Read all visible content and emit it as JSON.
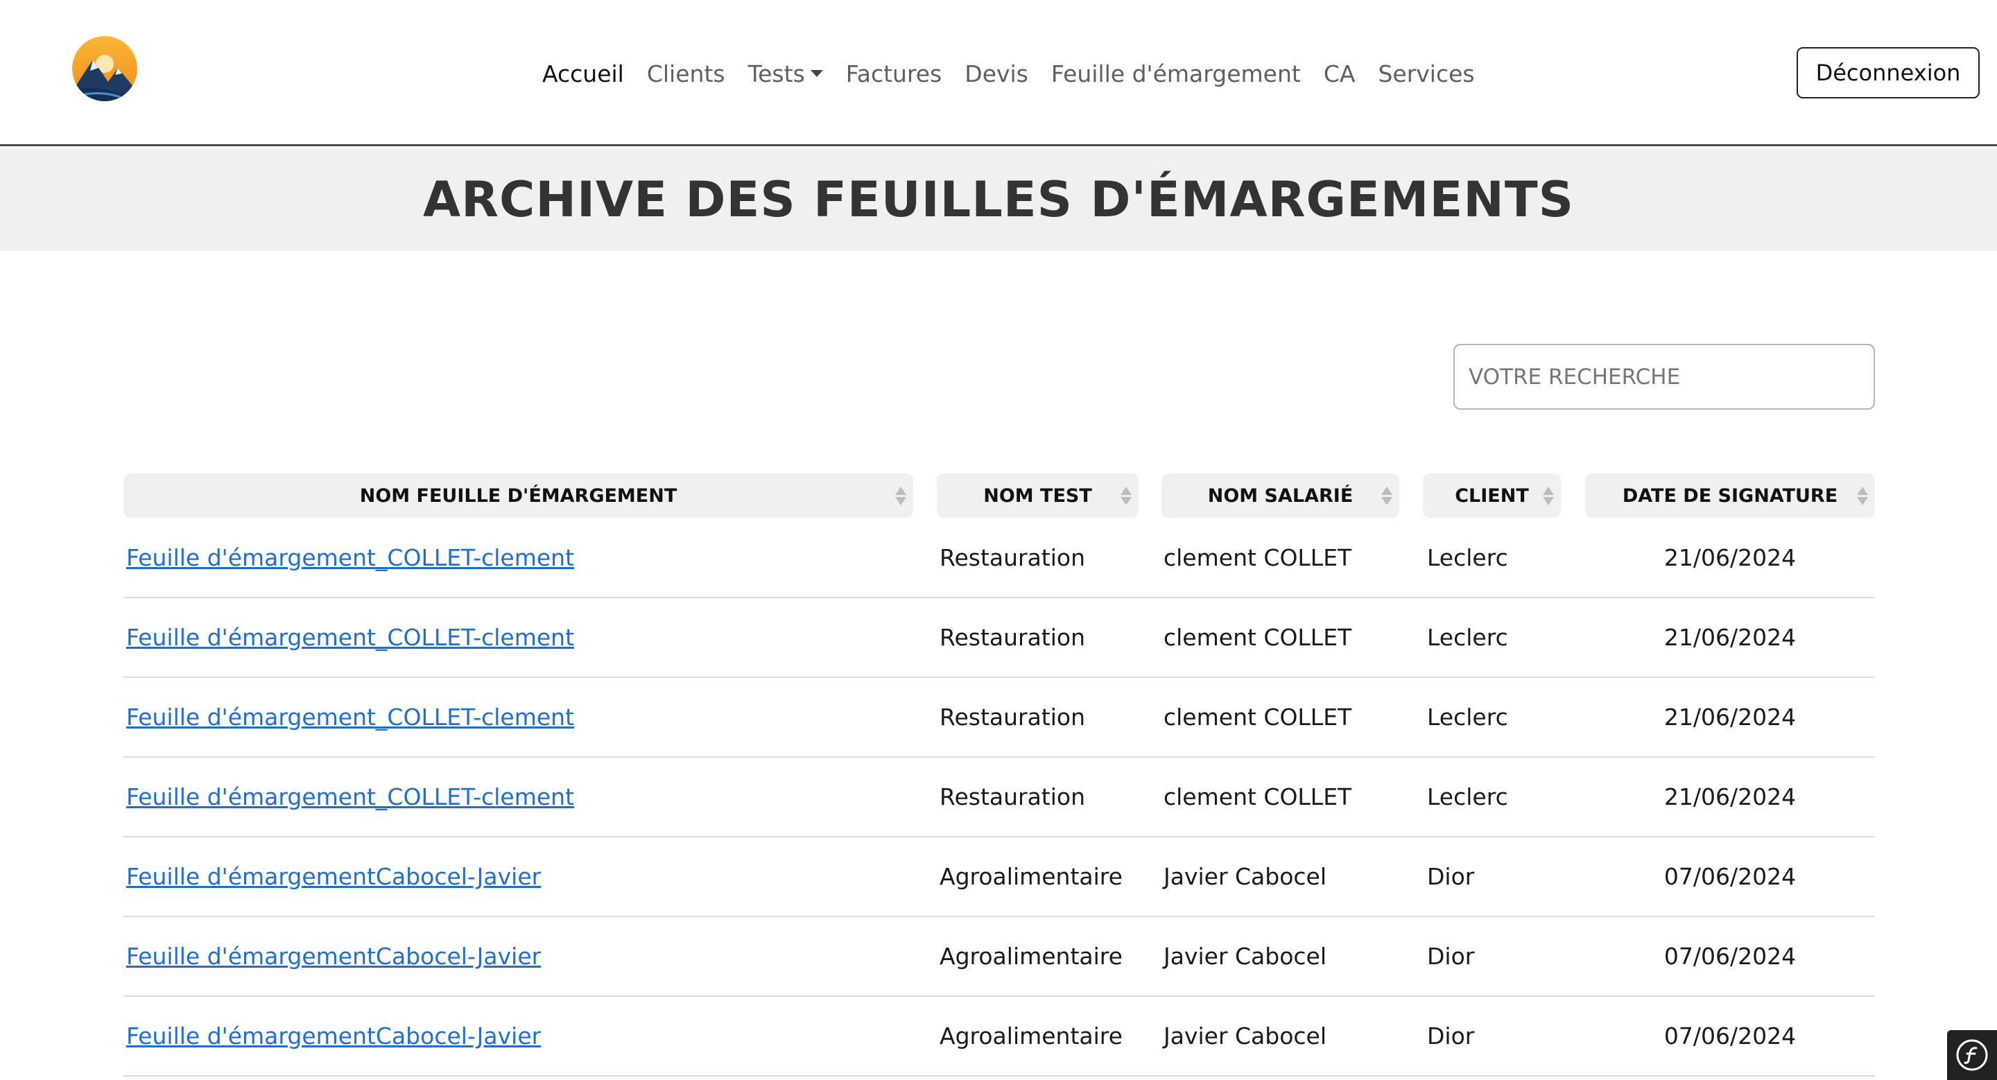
{
  "nav": {
    "items": [
      {
        "label": "Accueil",
        "active": true
      },
      {
        "label": "Clients"
      },
      {
        "label": "Tests",
        "dropdown": true
      },
      {
        "label": "Factures"
      },
      {
        "label": "Devis"
      },
      {
        "label": "Feuille d'émargement"
      },
      {
        "label": "CA"
      },
      {
        "label": "Services"
      }
    ],
    "logout_label": "Déconnexion"
  },
  "page": {
    "title": "ARCHIVE DES FEUILLES D'ÉMARGEMENTS"
  },
  "search": {
    "placeholder": "VOTRE RECHERCHE",
    "value": ""
  },
  "table": {
    "headers": [
      "NOM FEUILLE D'ÉMARGEMENT",
      "NOM TEST",
      "NOM SALARIÉ",
      "CLIENT",
      "DATE DE SIGNATURE"
    ],
    "rows": [
      {
        "sheet": "Feuille d'émargement_COLLET-clement",
        "test": "Restauration",
        "employee": "clement COLLET",
        "client": "Leclerc",
        "date": "21/06/2024"
      },
      {
        "sheet": "Feuille d'émargement_COLLET-clement",
        "test": "Restauration",
        "employee": "clement COLLET",
        "client": "Leclerc",
        "date": "21/06/2024"
      },
      {
        "sheet": "Feuille d'émargement_COLLET-clement",
        "test": "Restauration",
        "employee": "clement COLLET",
        "client": "Leclerc",
        "date": "21/06/2024"
      },
      {
        "sheet": "Feuille d'émargement_COLLET-clement",
        "test": "Restauration",
        "employee": "clement COLLET",
        "client": "Leclerc",
        "date": "21/06/2024"
      },
      {
        "sheet": "Feuille d'émargementCabocel-Javier",
        "test": "Agroalimentaire",
        "employee": "Javier Cabocel",
        "client": "Dior",
        "date": "07/06/2024"
      },
      {
        "sheet": "Feuille d'émargementCabocel-Javier",
        "test": "Agroalimentaire",
        "employee": "Javier Cabocel",
        "client": "Dior",
        "date": "07/06/2024"
      },
      {
        "sheet": "Feuille d'émargementCabocel-Javier",
        "test": "Agroalimentaire",
        "employee": "Javier Cabocel",
        "client": "Dior",
        "date": "07/06/2024"
      }
    ]
  },
  "colors": {
    "link": "#1f6fd1",
    "header_bg": "#f0f0f0",
    "title": "#333333"
  },
  "icons": {
    "logo": "mountain-sunset-logo",
    "sort": "sort-arrows-icon",
    "debug_toolbar": "symfony-icon"
  }
}
